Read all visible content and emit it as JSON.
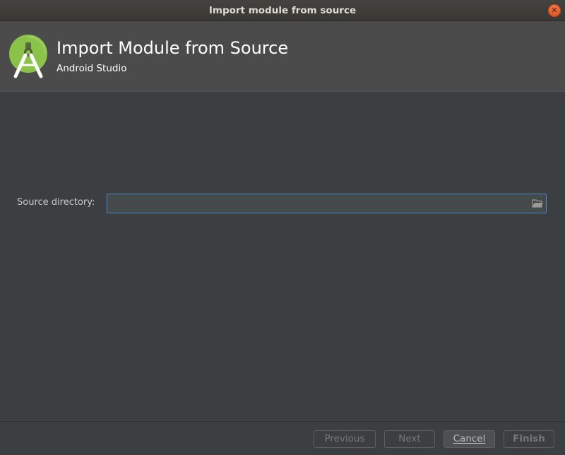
{
  "window": {
    "title": "Import module from source",
    "close_glyph": "✕",
    "close_icon": "close-icon"
  },
  "header": {
    "title": "Import Module from Source",
    "subtitle": "Android Studio",
    "logo_icon": "android-studio-logo-icon"
  },
  "form": {
    "source_directory_label": "Source directory:",
    "source_directory_value": "",
    "browse_icon": "folder-icon"
  },
  "footer": {
    "previous_label": "Previous",
    "next_label": "Next",
    "cancel_label": "Cancel",
    "finish_label": "Finish"
  },
  "colors": {
    "background": "#3c3f41",
    "header_background": "#4b4b4b",
    "input_focus_border": "#4a88c7",
    "close_button": "#e95420",
    "logo_green": "#8bc34a"
  }
}
